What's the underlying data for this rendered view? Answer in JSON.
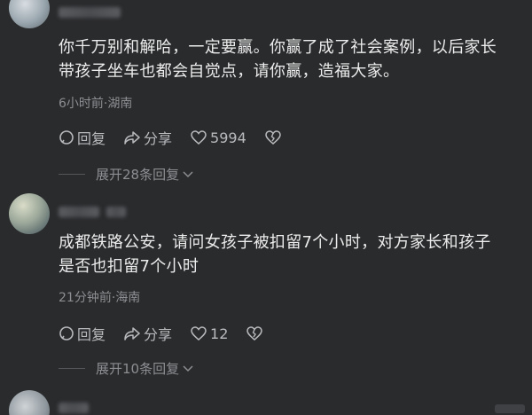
{
  "comments": [
    {
      "text_line1": "你千万别和解哈，一定要赢。你赢了成了社会案例，以后家长",
      "text_line2": "带孩子坐车也都会自觉点，请你赢，造福大家。",
      "meta": "6小时前·湖南",
      "reply_label": "回复",
      "share_label": "分享",
      "like_count": "5994",
      "expand_label": "展开28条回复"
    },
    {
      "text_line1": "成都铁路公安，请问女孩子被扣留7个小时，对方家长和孩子",
      "text_line2": "是否也扣留7个小时",
      "meta": "21分钟前·海南",
      "reply_label": "回复",
      "share_label": "分享",
      "like_count": "12",
      "expand_label": "展开10条回复"
    }
  ],
  "icons": [
    "reply-icon",
    "share-icon",
    "like-icon",
    "dislike-icon",
    "chevron-down-icon"
  ]
}
